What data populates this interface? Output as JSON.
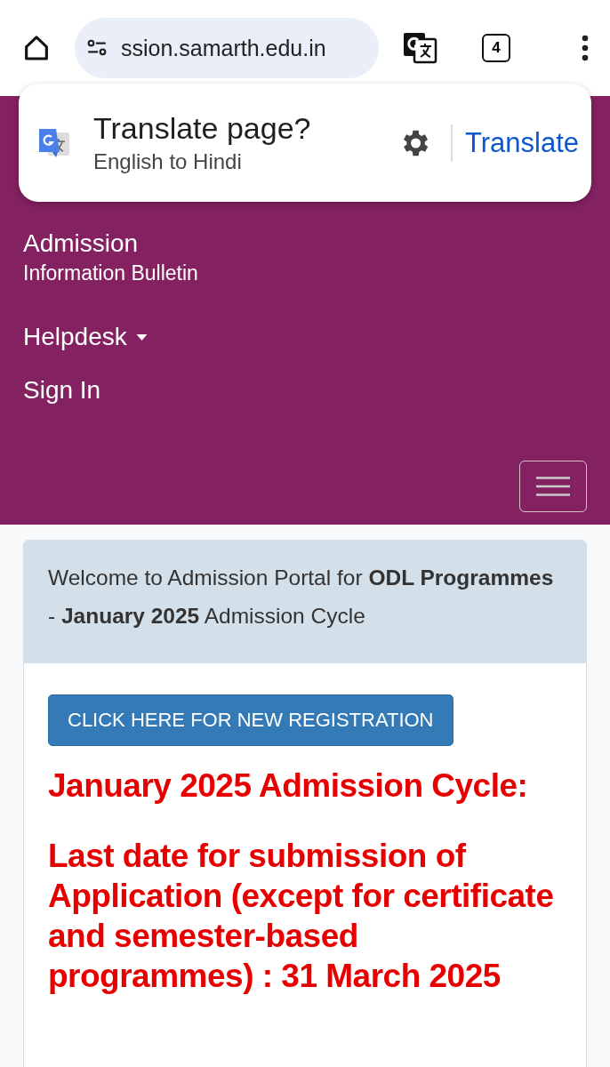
{
  "browser": {
    "url": "ssion.samarth.edu.in",
    "tab_count": "4"
  },
  "translate_popup": {
    "title": "Translate page?",
    "subtitle": "English to Hindi",
    "action": "Translate"
  },
  "nav": {
    "items": [
      {
        "kind": "link",
        "title": "Admission",
        "subtitle": "Information Bulletin"
      },
      {
        "kind": "dropdown",
        "title": "Helpdesk"
      },
      {
        "kind": "link",
        "title": "Sign In"
      }
    ]
  },
  "welcome": "Welcome to Admission Portal for **ODL Programmes** - **January 2025** Admission Cycle",
  "register_button": "CLICK HERE FOR NEW REGISTRATION",
  "notices": [
    "January 2025 Admission Cycle:",
    "Last date for submission of Application (except for certificate and semester-based programmes) : 31 March 2025"
  ]
}
